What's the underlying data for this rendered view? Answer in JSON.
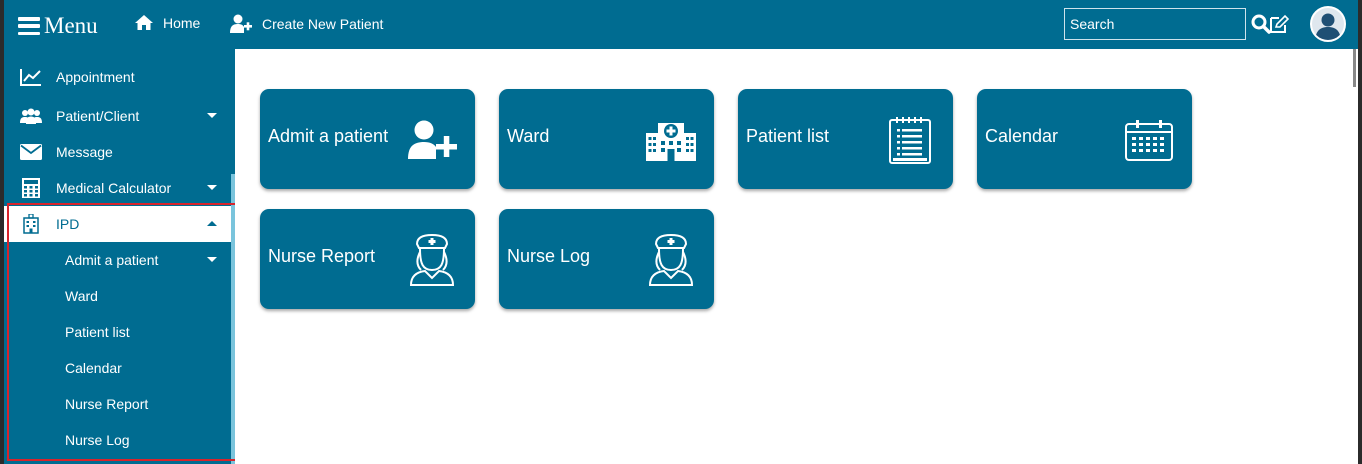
{
  "header": {
    "menu_label": "Menu",
    "home_label": "Home",
    "create_patient_label": "Create New Patient",
    "search_placeholder": "Search"
  },
  "sidebar": {
    "items": [
      {
        "label": "Appointment",
        "icon": "line-chart-icon"
      },
      {
        "label": "Patient/Client",
        "icon": "users-icon"
      },
      {
        "label": "Message",
        "icon": "envelope-icon"
      },
      {
        "label": "Medical Calculator",
        "icon": "calculator-icon"
      },
      {
        "label": "IPD",
        "icon": "hospital-building-icon"
      }
    ],
    "sub_items": [
      {
        "label": "Admit a patient"
      },
      {
        "label": "Ward"
      },
      {
        "label": "Patient list"
      },
      {
        "label": "Calendar"
      },
      {
        "label": "Nurse Report"
      },
      {
        "label": "Nurse Log"
      }
    ]
  },
  "tiles": [
    {
      "label": "Admit a patient",
      "icon": "user-plus-icon"
    },
    {
      "label": "Ward",
      "icon": "hospital-icon"
    },
    {
      "label": "Patient list",
      "icon": "notepad-list-icon"
    },
    {
      "label": "Calendar",
      "icon": "calendar-icon"
    },
    {
      "label": "Nurse Report",
      "icon": "nurse-icon"
    },
    {
      "label": "Nurse Log",
      "icon": "nurse-icon"
    }
  ],
  "colors": {
    "brand": "#006c91",
    "highlight": "#d9242b",
    "background": "#ffffff"
  }
}
